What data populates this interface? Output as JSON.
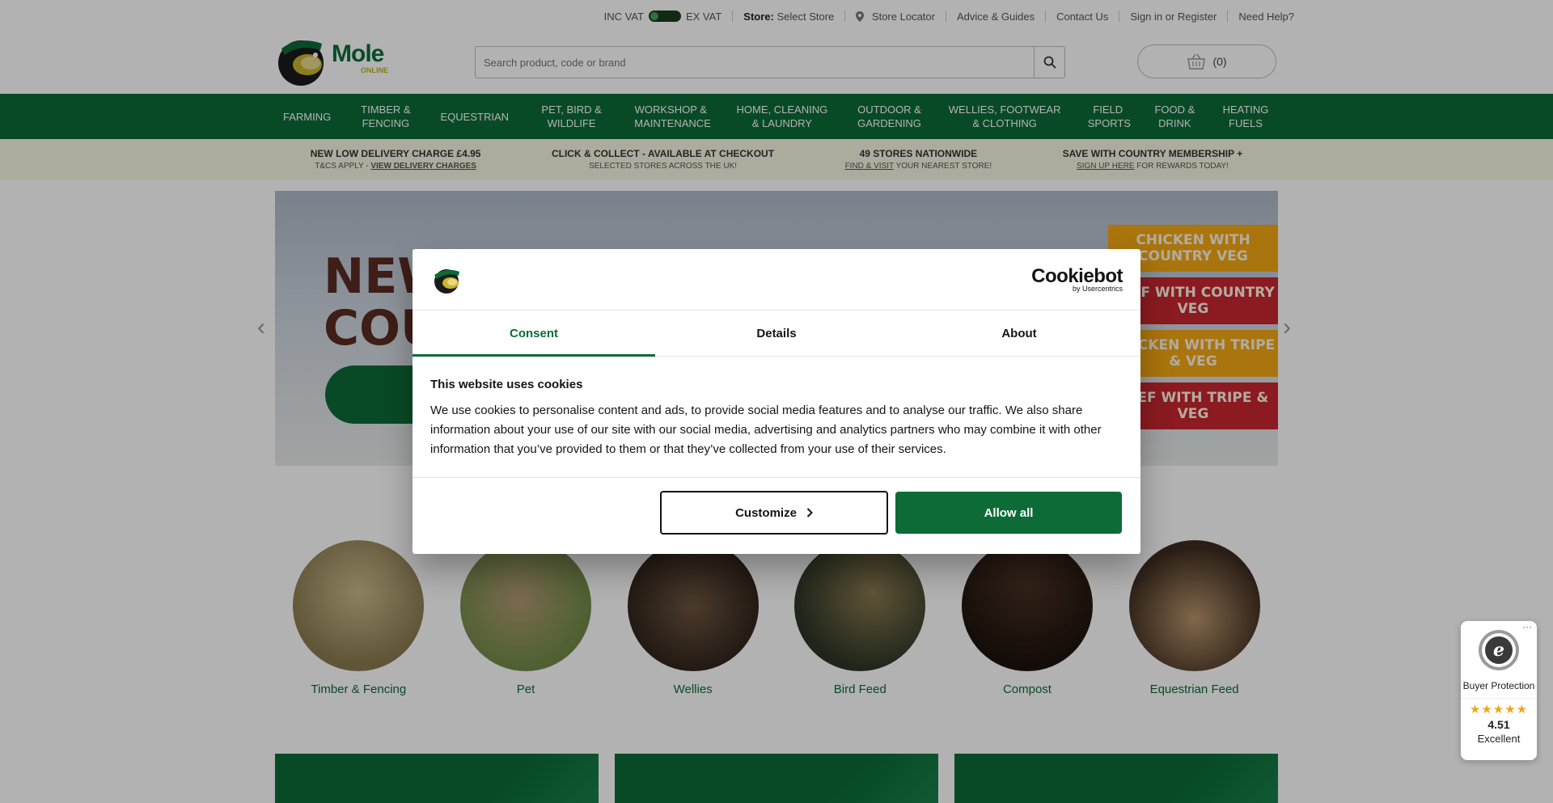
{
  "topbar": {
    "inc_vat": "INC VAT",
    "ex_vat": "EX VAT",
    "store_label": "Store:",
    "store_value": "Select Store",
    "store_locator": "Store Locator",
    "advice": "Advice & Guides",
    "contact": "Contact Us",
    "signin": "Sign in or Register",
    "help": "Need Help?"
  },
  "header": {
    "logo_text": "Mole",
    "logo_sub": "ONLINE",
    "search_placeholder": "Search product, code or brand",
    "basket_count": "(0)"
  },
  "nav": {
    "items": [
      "Farming",
      "Timber & Fencing",
      "Equestrian",
      "Pet, Bird & Wildlife",
      "Workshop & Maintenance",
      "Home, Cleaning & Laundry",
      "Outdoor & Gardening",
      "Wellies, Footwear & Clothing",
      "Field Sports",
      "Food & Drink",
      "Heating Fuels"
    ]
  },
  "usp": [
    {
      "title": "NEW LOW DELIVERY CHARGE £4.95",
      "sub_a": "T&CS APPLY - ",
      "link": "VIEW DELIVERY CHARGES",
      "sub_b": ""
    },
    {
      "title": "CLICK & COLLECT - AVAILABLE AT CHECKOUT",
      "sub_a": "SELECTED STORES ACROSS THE UK!",
      "link": "",
      "sub_b": ""
    },
    {
      "title": "49 STORES NATIONWIDE",
      "sub_a": "",
      "link": "FIND & VISIT",
      "sub_b": " YOUR NEAREST STORE!"
    },
    {
      "title": "SAVE WITH COUNTRY MEMBERSHIP +",
      "sub_a": "",
      "link": "SIGN UP HERE",
      "sub_b": " FOR REWARDS TODAY!"
    }
  ],
  "hero": {
    "title_line1": "NEW",
    "title_line2": "COU",
    "flavours": [
      "Chicken with Country Veg",
      "Beef with Country Veg",
      "Chicken with Tripe & Veg",
      "Beef with Tripe & Veg"
    ],
    "prev_arrow": "‹",
    "next_arrow": "›"
  },
  "categories": [
    {
      "label": "Timber & Fencing",
      "color": "#8a7a4e"
    },
    {
      "label": "Pet",
      "color": "#8a9a6c"
    },
    {
      "label": "Wellies",
      "color": "#4b3a2c"
    },
    {
      "label": "Bird Feed",
      "color": "#3d4a33"
    },
    {
      "label": "Compost",
      "color": "#2e1f17"
    },
    {
      "label": "Equestrian Feed",
      "color": "#5a4332"
    }
  ],
  "cookie_dialog": {
    "brand": "Cookiebot",
    "brand_sub": "by Usercentrics",
    "tabs": [
      "Consent",
      "Details",
      "About"
    ],
    "heading": "This website uses cookies",
    "body": "We use cookies to personalise content and ads, to provide social media features and to analyse our traffic. We also share information about your use of our site with our social media, advertising and analytics partners who may combine it with other information that you’ve provided to them or that they’ve collected from your use of their services.",
    "customize": "Customize",
    "allow_all": "Allow all"
  },
  "trusted": {
    "more": "···",
    "label": "Buyer Protection",
    "stars": "★★★★★",
    "score": "4.51",
    "rating": "Excellent"
  },
  "colors": {
    "brand_green": "#0c6b37",
    "usp_bg": "#f6f6e2",
    "star": "#f0a41c"
  }
}
